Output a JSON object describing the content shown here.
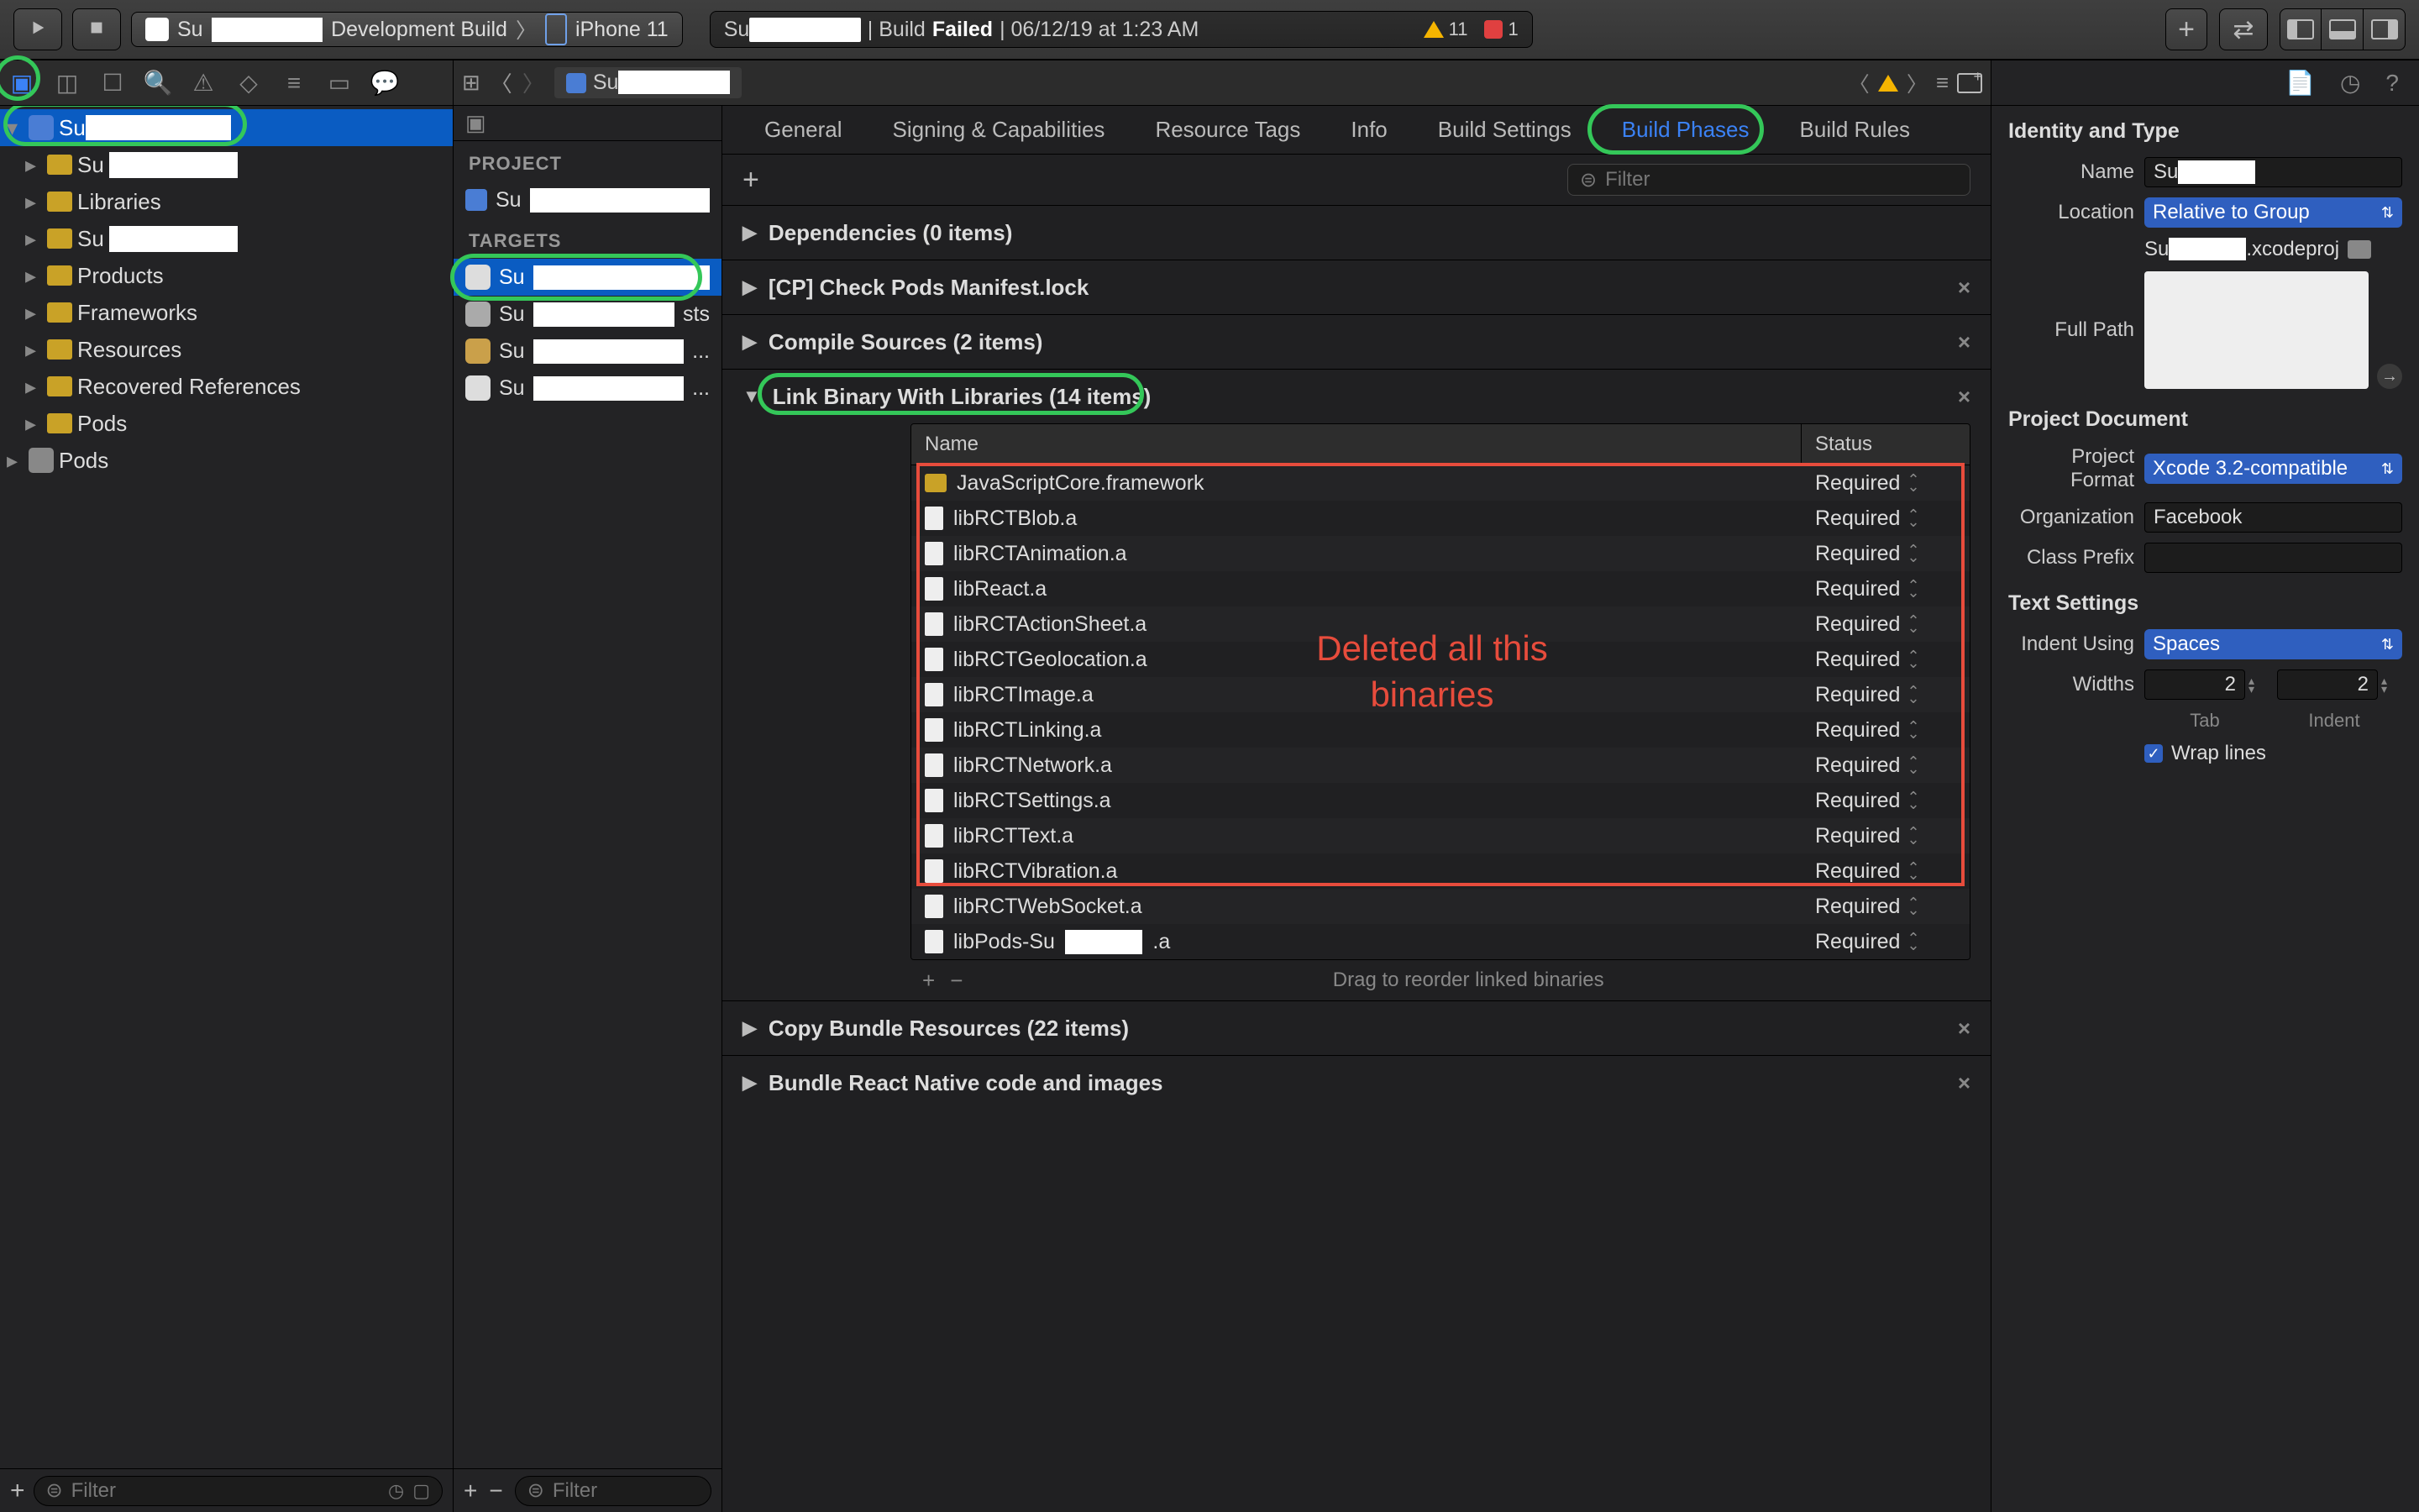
{
  "toolbar": {
    "scheme_prefix": "Su",
    "scheme_suffix": "Development Build",
    "device": "iPhone 11"
  },
  "status": {
    "prefix": "Su",
    "mid": " | Build ",
    "failed": "Failed",
    "tail": " | 06/12/19 at 1:23 AM",
    "warnings": "11",
    "errors": "1"
  },
  "nav_tree": {
    "root_prefix": "Su",
    "items": [
      {
        "prefix": "Su",
        "folder": "yellow"
      },
      {
        "label": "Libraries",
        "folder": "yellow"
      },
      {
        "prefix": "Su",
        "folder": "yellow"
      },
      {
        "label": "Products",
        "folder": "yellow"
      },
      {
        "label": "Frameworks",
        "folder": "yellow"
      },
      {
        "label": "Resources",
        "folder": "yellow"
      },
      {
        "label": "Recovered References",
        "folder": "yellow"
      },
      {
        "label": "Pods",
        "folder": "yellow"
      }
    ],
    "pods": "Pods"
  },
  "left_filter_placeholder": "Filter",
  "jump_bar": {
    "file_prefix": "Su"
  },
  "targets": {
    "project_label": "PROJECT",
    "project_prefix": "Su",
    "targets_label": "TARGETS",
    "rows": [
      {
        "prefix": "Su"
      },
      {
        "prefix": "Su",
        "suffix": "sts"
      },
      {
        "prefix": "Su",
        "suffix": "..."
      },
      {
        "prefix": "Su",
        "suffix": "..."
      }
    ],
    "filter_placeholder": "Filter"
  },
  "tabs": [
    "General",
    "Signing & Capabilities",
    "Resource Tags",
    "Info",
    "Build Settings",
    "Build Phases",
    "Build Rules"
  ],
  "phase_filter_placeholder": "Filter",
  "phases": {
    "deps": "Dependencies (0 items)",
    "cp": "[CP] Check Pods Manifest.lock",
    "compile": "Compile Sources (2 items)",
    "link": "Link Binary With Libraries (14 items)",
    "copy": "Copy Bundle Resources (22 items)",
    "bundle": "Bundle React Native code and images"
  },
  "lib_table": {
    "col_name": "Name",
    "col_status": "Status",
    "rows": [
      {
        "name": "JavaScriptCore.framework",
        "status": "Required",
        "icon": "fw"
      },
      {
        "name": "libRCTBlob.a",
        "status": "Required",
        "icon": "a"
      },
      {
        "name": "libRCTAnimation.a",
        "status": "Required",
        "icon": "a"
      },
      {
        "name": "libReact.a",
        "status": "Required",
        "icon": "a"
      },
      {
        "name": "libRCTActionSheet.a",
        "status": "Required",
        "icon": "a"
      },
      {
        "name": "libRCTGeolocation.a",
        "status": "Required",
        "icon": "a"
      },
      {
        "name": "libRCTImage.a",
        "status": "Required",
        "icon": "a"
      },
      {
        "name": "libRCTLinking.a",
        "status": "Required",
        "icon": "a"
      },
      {
        "name": "libRCTNetwork.a",
        "status": "Required",
        "icon": "a"
      },
      {
        "name": "libRCTSettings.a",
        "status": "Required",
        "icon": "a"
      },
      {
        "name": "libRCTText.a",
        "status": "Required",
        "icon": "a"
      },
      {
        "name": "libRCTVibration.a",
        "status": "Required",
        "icon": "a"
      },
      {
        "name": "libRCTWebSocket.a",
        "status": "Required",
        "icon": "a"
      },
      {
        "name_prefix": "libPods-Su",
        "name_suffix": ".a",
        "status": "Required",
        "icon": "a",
        "masked": true
      }
    ],
    "footer_hint": "Drag to reorder linked binaries"
  },
  "annotation": "Deleted all this binaries",
  "inspector": {
    "identity_title": "Identity and Type",
    "name_label": "Name",
    "name_prefix": "Su",
    "location_label": "Location",
    "location_value": "Relative to Group",
    "location_file_prefix": "Su",
    "location_file_suffix": ".xcodeproj",
    "fullpath_label": "Full Path",
    "projdoc_title": "Project Document",
    "projfmt_label": "Project Format",
    "projfmt_value": "Xcode 3.2-compatible",
    "org_label": "Organization",
    "org_value": "Facebook",
    "classprefix_label": "Class Prefix",
    "classprefix_value": "",
    "text_title": "Text Settings",
    "indent_label": "Indent Using",
    "indent_value": "Spaces",
    "widths_label": "Widths",
    "tab_val": "2",
    "indent_val": "2",
    "tab_caption": "Tab",
    "indent_caption": "Indent",
    "wrap_label": "Wrap lines"
  }
}
